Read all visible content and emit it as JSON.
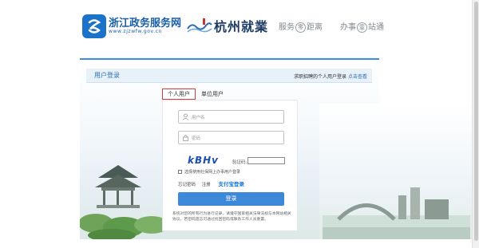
{
  "header": {
    "logo_title": "浙江政务服务网",
    "logo_url_text": "www.zjzwfw.gov.cn",
    "partner_title": "杭州就業",
    "slogan1": {
      "a": "服务",
      "circle": "零",
      "b": "距离"
    },
    "slogan2": {
      "a": "办事",
      "circle": "壹",
      "b": "站通"
    }
  },
  "titlebar": {
    "label": "用户登录",
    "right_text": "求职招聘的个人用户登录",
    "right_link": "点击查看"
  },
  "tabs": {
    "personal": "个人用户",
    "company": "单位用户"
  },
  "form": {
    "username_placeholder": "用户名",
    "password_placeholder": "密码",
    "captcha_text": "kBHv",
    "captcha_label": "验证码:",
    "agree_text": "选择使用社保网上办事用户登录",
    "forgot": "忘记密码",
    "register": "注册",
    "alipay": "支付宝登录",
    "login_button": "登录",
    "notice": "系统对您的所有行为进行记录，请遵守国家相关法律法规与本网站相关协议，若密码遗忘可通过找回密码或联系工作人员重置。"
  },
  "colors": {
    "accent": "#3d88d8",
    "brand": "#1a5fa8",
    "tab_border": "#d43b3b"
  }
}
